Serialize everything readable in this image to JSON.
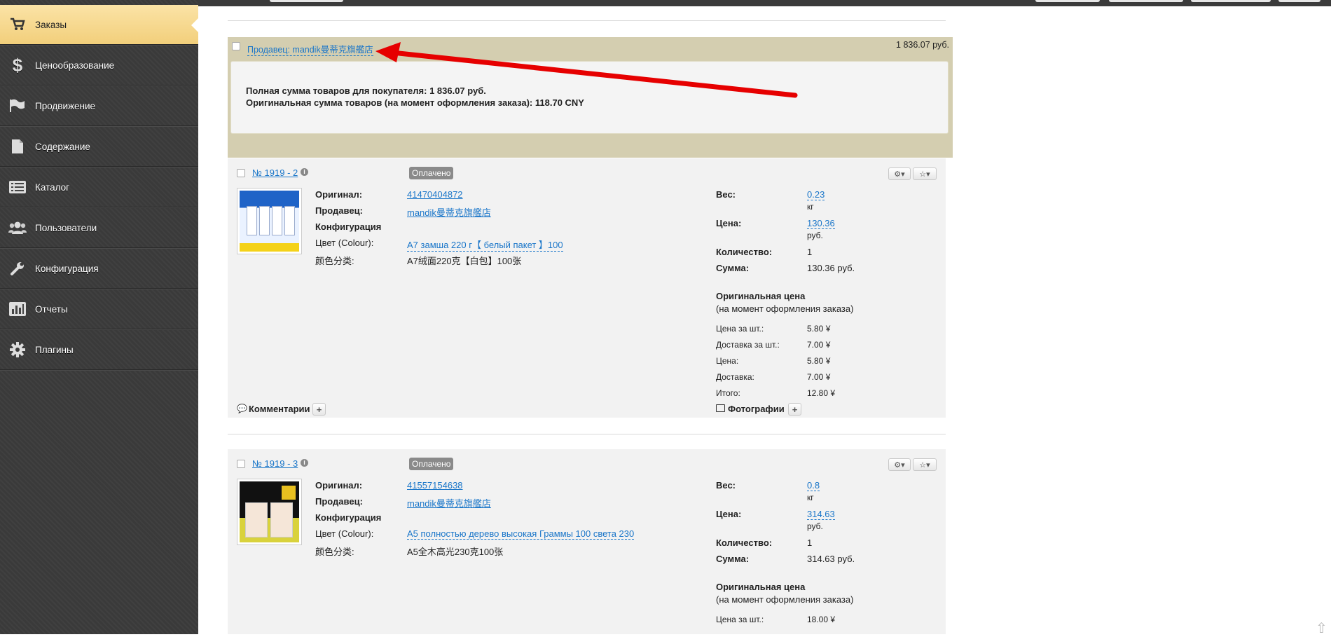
{
  "sidebar": {
    "items": [
      {
        "label": "Заказы",
        "icon": "cart-icon",
        "active": true
      },
      {
        "label": "Ценообразование",
        "icon": "dollar-icon"
      },
      {
        "label": "Продвижение",
        "icon": "flag-icon"
      },
      {
        "label": "Содержание",
        "icon": "document-icon"
      },
      {
        "label": "Каталог",
        "icon": "list-icon"
      },
      {
        "label": "Пользователи",
        "icon": "users-icon"
      },
      {
        "label": "Конфигурация",
        "icon": "wrench-icon"
      },
      {
        "label": "Отчеты",
        "icon": "chart-icon"
      },
      {
        "label": "Плагины",
        "icon": "gear-icon"
      }
    ]
  },
  "seller": {
    "link": "Продавец: mandik曼蒂克旗艦店",
    "total": "1 836.07 руб.",
    "line1": "Полная сумма товаров для покупателя: 1 836.07 руб.",
    "line2": "Оригинальная сумма товаров (на момент оформления заказа): 118.70 CNY"
  },
  "labels": {
    "original": "Оригинал:",
    "seller": "Продавец:",
    "config": "Конфигурация",
    "color": "Цвет (Colour):",
    "color_cn": "颜色分类:",
    "weight": "Вес:",
    "kg": "кг",
    "price": "Цена:",
    "rub": "руб.",
    "qty": "Количество:",
    "sum": "Сумма:",
    "orig_price": "Оригинальная цена",
    "orig_note": "(на момент оформления заказа)",
    "unit_price": "Цена за шт.:",
    "unit_delivery": "Доставка за шт.:",
    "price2": "Цена:",
    "delivery": "Доставка:",
    "total": "Итого:",
    "comments": "Комментарии",
    "photos": "Фотографии"
  },
  "items": [
    {
      "number": "№ 1919 - 2",
      "status": "Оплачено",
      "original": "41470404872",
      "seller": "mandik曼蒂克旗艦店",
      "color": "A7 замша 220 г【 белый пакет 】100",
      "color_cn": "A7绒面220克【白包】100张",
      "weight": "0.23",
      "price": "130.36",
      "qty": "1",
      "sum": "130.36 руб.",
      "unit_price": "5.80 ¥",
      "unit_delivery": "7.00 ¥",
      "price2": "5.80 ¥",
      "delivery": "7.00 ¥",
      "total": "12.80 ¥"
    },
    {
      "number": "№ 1919 - 3",
      "status": "Оплачено",
      "original": "41557154638",
      "seller": "mandik曼蒂克旗艦店",
      "color": "A5 полностью дерево высокая Граммы 100 света 230",
      "color_cn": "A5全木高光230克100张",
      "weight": "0.8",
      "price": "314.63",
      "qty": "1",
      "sum": "314.63 руб.",
      "unit_price": "18.00 ¥"
    }
  ],
  "colors": {
    "accent_link": "#1a76c9",
    "active_nav": "#f2cf7b",
    "seller_bg": "#d4ceb0",
    "arrow": "#e60000"
  }
}
